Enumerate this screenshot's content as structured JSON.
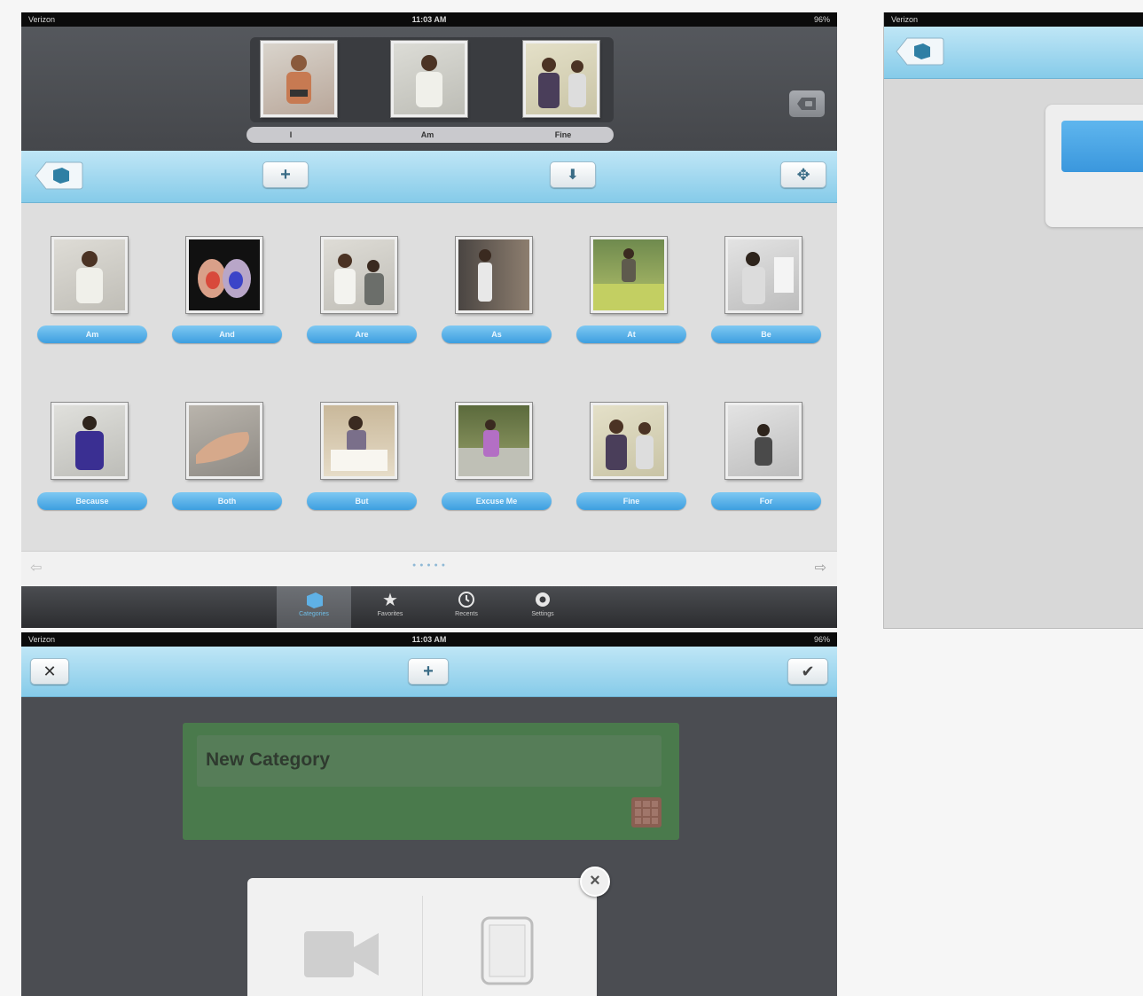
{
  "screen1": {
    "status": {
      "carrier": "Verizon",
      "time": "11:03 AM",
      "battery": "96%"
    },
    "sentence": {
      "words": [
        "I",
        "Am",
        "Fine"
      ]
    },
    "toolbar": {
      "add_label": "+",
      "download_label": "⬇",
      "move_label": "✥"
    },
    "grid": {
      "row1": [
        "Am",
        "And",
        "Are",
        "As",
        "At",
        "Be"
      ],
      "row2": [
        "Because",
        "Both",
        "But",
        "Excuse Me",
        "Fine",
        "For"
      ]
    },
    "pager": {
      "prev": "⇦",
      "next": "⇨",
      "dots": "● ● ● ● ●"
    },
    "tabs": [
      {
        "label": "Categories",
        "icon": "cube-icon"
      },
      {
        "label": "Favorites",
        "icon": "star-icon"
      },
      {
        "label": "Recents",
        "icon": "clock-icon"
      },
      {
        "label": "Settings",
        "icon": "gear-icon"
      }
    ]
  },
  "screen2": {
    "status": {
      "carrier": "Verizon",
      "time": "",
      "battery": ""
    }
  },
  "screen3": {
    "status": {
      "carrier": "Verizon",
      "time": "11:03 AM",
      "battery": "96%"
    },
    "toolbar": {
      "cancel_label": "✕",
      "add_label": "+",
      "done_label": "✔"
    },
    "category_name": "New Category",
    "popup_close": "×"
  },
  "colors": {
    "accent_blue": "#3d9fe0",
    "toolbar_blue": "#a6d9f0",
    "dark_bg": "#4b4d52",
    "panel_green": "#4a7a4c"
  }
}
